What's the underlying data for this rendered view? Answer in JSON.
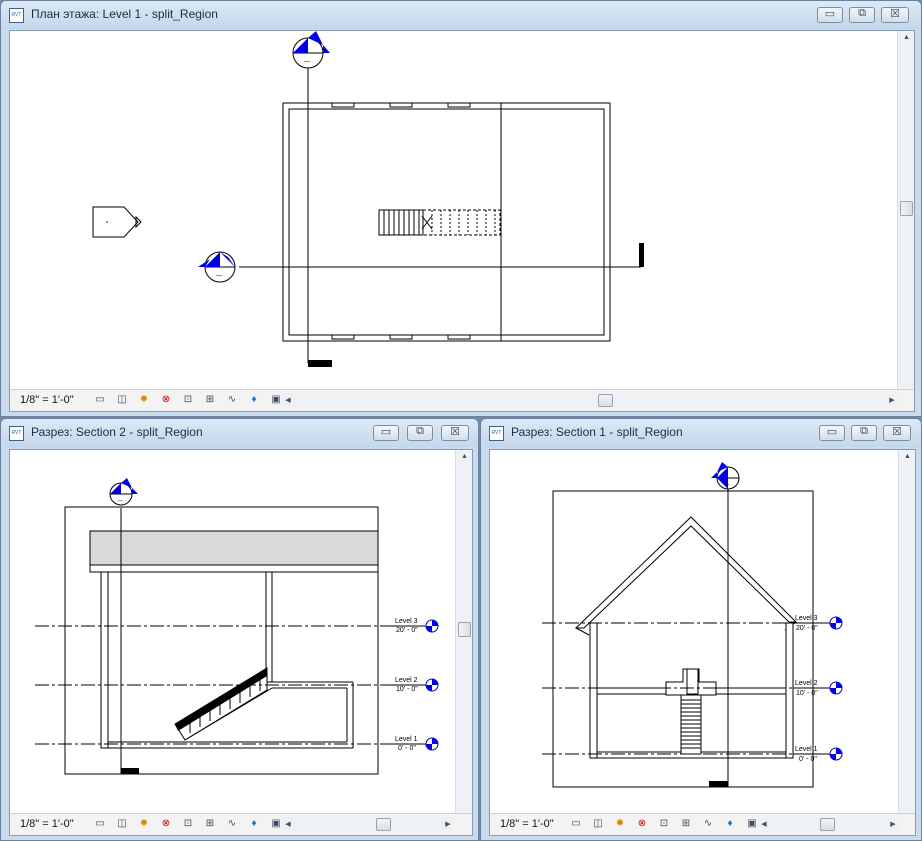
{
  "windows": {
    "floor_plan": {
      "title": "План этажа: Level 1 - split_Region",
      "scale": "1/8\" = 1'-0\""
    },
    "section2": {
      "title": "Разрез: Section 2 - split_Region",
      "scale": "1/8\" = 1'-0\""
    },
    "section1": {
      "title": "Разрез: Section 1 - split_Region",
      "scale": "1/8\" = 1'-0\""
    }
  },
  "levels": [
    {
      "name": "Level 3",
      "elevation": "20' - 0\""
    },
    {
      "name": "Level 2",
      "elevation": "10' - 0\""
    },
    {
      "name": "Level 1",
      "elevation": "0' - 0\""
    }
  ],
  "app_icon_text": "RVT",
  "window_buttons": {
    "minimize": "▭",
    "restore": "⧉",
    "close": "☒"
  },
  "view_tools": [
    {
      "name": "detail-level-icon",
      "glyph": "▭"
    },
    {
      "name": "visual-style-icon",
      "glyph": "◫"
    },
    {
      "name": "sun-path-icon",
      "glyph": "✹"
    },
    {
      "name": "shadows-icon",
      "glyph": "⊗"
    },
    {
      "name": "crop-view-icon",
      "glyph": "⊡"
    },
    {
      "name": "crop-region-icon",
      "glyph": "⊞"
    },
    {
      "name": "temporary-hide-icon",
      "glyph": "∿"
    },
    {
      "name": "reveal-hidden-icon",
      "glyph": "♦"
    },
    {
      "name": "analysis-display-icon",
      "glyph": "▣"
    }
  ],
  "colors": {
    "marker_blue": "#0000e6",
    "title_bg": "#c9dcef"
  }
}
